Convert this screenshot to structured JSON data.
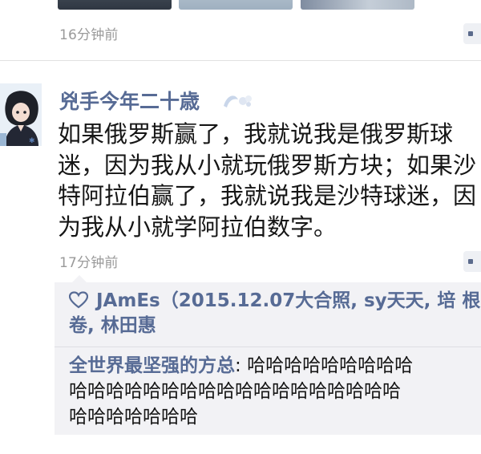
{
  "previous_post": {
    "timestamp": "16分钟前"
  },
  "post": {
    "author": "兇手今年二十歳",
    "text_lines": [
      "如果俄罗斯赢了，我就说我是俄罗斯球",
      "迷，因为我从小就玩俄罗斯方块；如果沙",
      "特阿拉伯赢了，我就说我是沙特球迷，因",
      "为我从小就学阿拉伯数字。"
    ],
    "timestamp": "17分钟前",
    "likes": {
      "icon": "heart-icon",
      "line1": "JAmEs（2015.12.07大合照, sy天天, 培",
      "line2": "根卷, 林田惠"
    },
    "comment": {
      "author": "全世界最坚强的方总",
      "separator": ": ",
      "line1": "哈哈哈哈哈哈哈哈哈",
      "line2": "哈哈哈哈哈哈哈哈哈哈哈哈哈哈哈哈哈哈",
      "line3": "哈哈哈哈哈哈哈"
    }
  },
  "colors": {
    "link_blue": "#576b95",
    "time_gray": "#9a9a9a",
    "comment_bg": "#f2f2f5"
  }
}
